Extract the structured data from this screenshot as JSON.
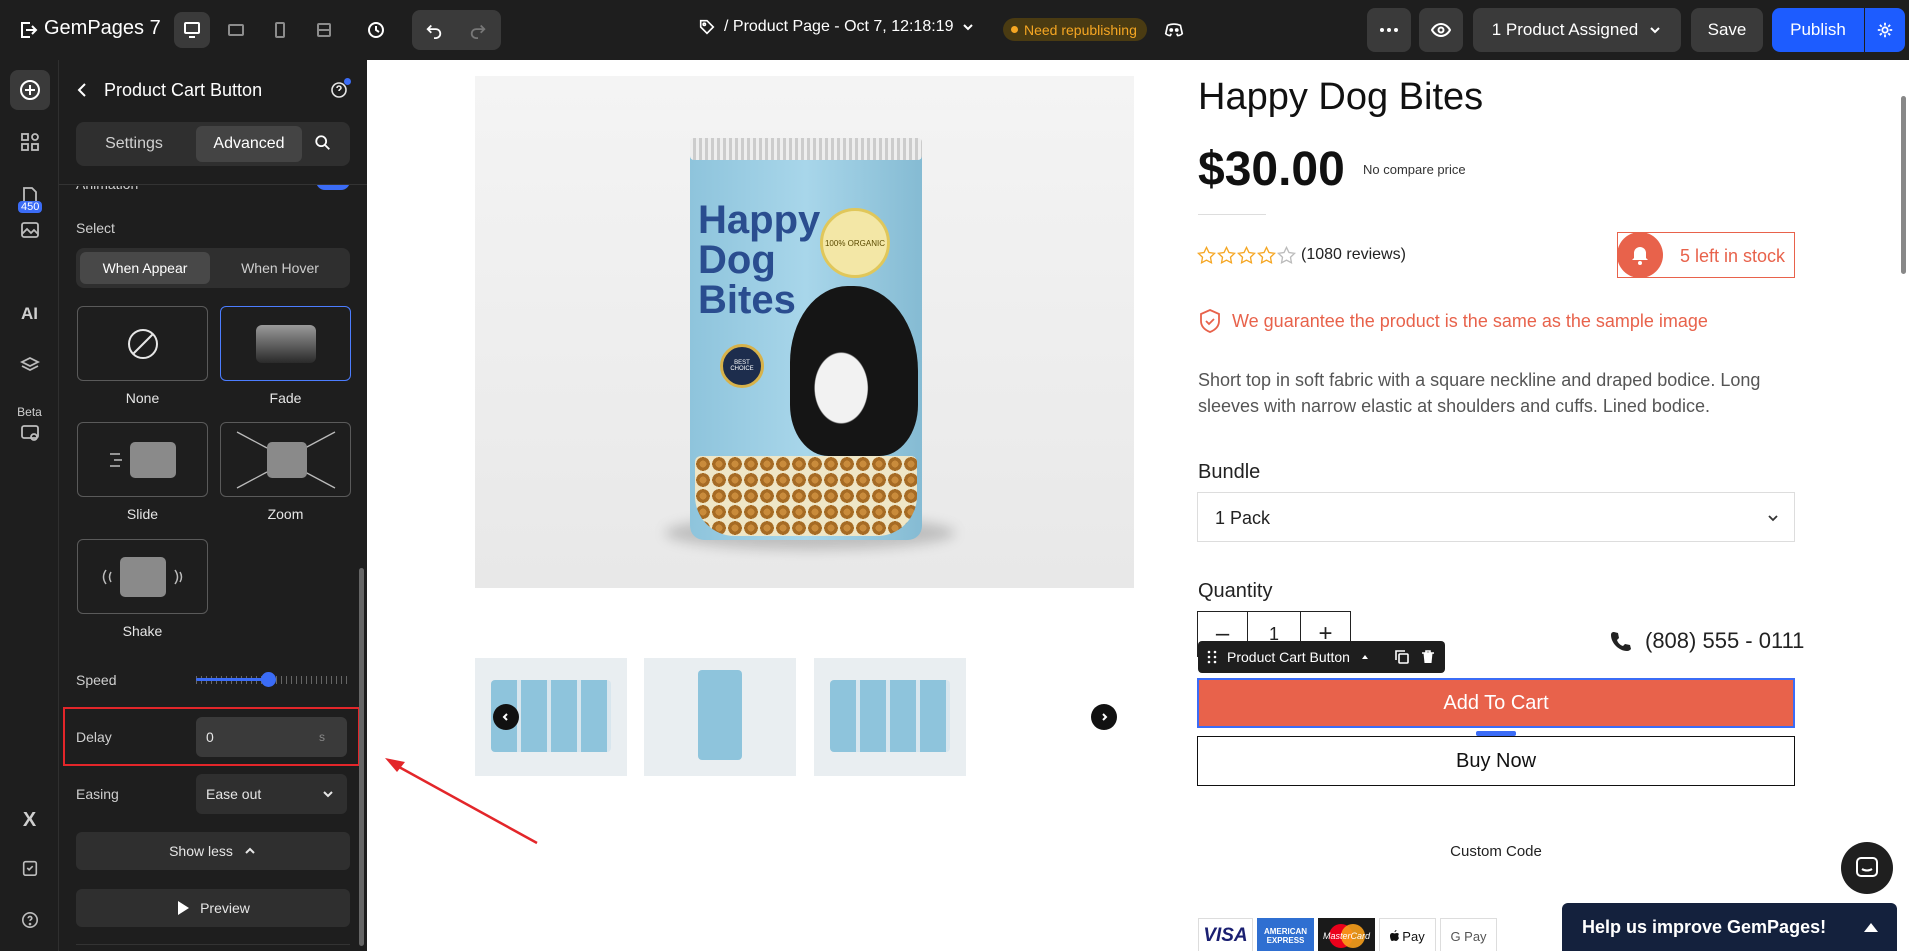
{
  "topbar": {
    "brand": "GemPages",
    "brand_version": "7",
    "page_title": "/ Product Page - Oct 7, 12:18:19",
    "republish_badge": "Need republishing",
    "product_assigned": "1 Product Assigned",
    "save_label": "Save",
    "publish_label": "Publish"
  },
  "rail": {
    "badge_count": "450",
    "beta_label": "Beta",
    "ai_label": "AI"
  },
  "panel": {
    "title": "Product Cart Button",
    "tabs": [
      "Settings",
      "Advanced"
    ],
    "animation_label": "Animation",
    "select_label": "Select",
    "trigger_options": [
      "When Appear",
      "When Hover"
    ],
    "effects": [
      "None",
      "Fade",
      "Slide",
      "Zoom",
      "Shake"
    ],
    "speed_label": "Speed",
    "speed_value": 0.47,
    "delay_label": "Delay",
    "delay_value": "0",
    "delay_unit": "s",
    "easing_label": "Easing",
    "easing_value": "Ease out",
    "show_less_label": "Show less",
    "preview_label": "Preview"
  },
  "product": {
    "name": "Happy Dog Bites",
    "price": "$30.00",
    "compare_price": "No compare price",
    "reviews": "(1080 reviews)",
    "rating": 0,
    "stock": "5 left in stock",
    "guarantee": "We guarantee the product is the same as the sample image",
    "description": "Short top in soft fabric with a square neckline and draped bodice. Long sleeves with narrow elastic at shoulders and cuffs. Lined bodice.",
    "bundle_label": "Bundle",
    "bundle_value": "1 Pack",
    "quantity_label": "Quantity",
    "quantity_value": "1",
    "phone": "(808) 555 - 0111",
    "element_label": "Product Cart Button",
    "add_to_cart": "Add To Cart",
    "buy_now": "Buy Now",
    "custom_code": "Custom Code",
    "bag_text": [
      "Happy",
      "Dog",
      "Bites"
    ],
    "bag_badges": [
      "100% ORGANIC",
      "BEST CHOICE"
    ],
    "payment_methods": [
      "VISA",
      "AMERICAN EXPRESS",
      "MasterCard",
      "Pay",
      "G Pay"
    ]
  },
  "help_banner": "Help us improve GemPages!",
  "colors": {
    "accent_orange": "#e8624b",
    "publish_blue": "#1d5cff",
    "selection_blue": "#3b6cf6",
    "badge_orange": "#f5a623",
    "annotation_red": "#e3262a"
  }
}
